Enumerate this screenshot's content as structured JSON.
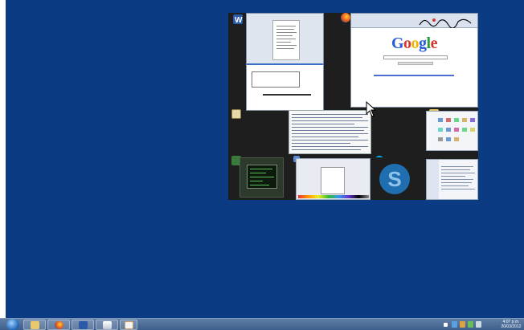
{
  "desktop": {
    "background_color": "#0b3b82"
  },
  "switcher": {
    "windows": [
      {
        "name": "word-window-thumbnail",
        "app_icon": "word-icon"
      },
      {
        "name": "firefox-window-thumbnail",
        "app_icon": "firefox-icon",
        "page_logo": "Google"
      },
      {
        "name": "notepad-window-thumbnail",
        "app_icon": "notepad-icon"
      },
      {
        "name": "explorer-window-thumbnail",
        "app_icon": "folder-icon"
      },
      {
        "name": "cmd-window-thumbnail",
        "app_icon": "monitor-icon"
      },
      {
        "name": "paint-window-thumbnail",
        "app_icon": "paint-icon"
      },
      {
        "name": "skype-window-thumbnail",
        "app_icon": "skype-icon"
      },
      {
        "name": "explorer-window-thumbnail-2",
        "app_icon": "folder-icon"
      }
    ]
  },
  "taskbar": {
    "start_icon": "windows-start-orb",
    "pinned": [
      "explorer-icon",
      "firefox-icon",
      "word-icon",
      "eject-icon",
      "paint-icon"
    ],
    "tray_icons": [
      "chevron-up-icon",
      "network-icon",
      "volume-icon",
      "flag-icon",
      "battery-icon"
    ],
    "clock": {
      "time": "4:07 p.m.",
      "date": "20/03/2012"
    }
  }
}
